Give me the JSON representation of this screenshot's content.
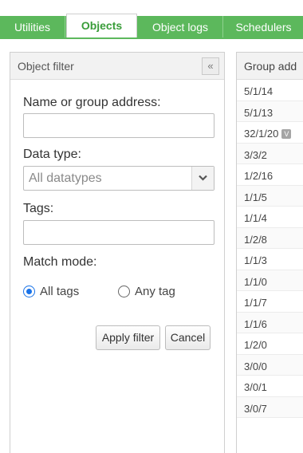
{
  "tabs": [
    {
      "label": "Utilities",
      "active": false
    },
    {
      "label": "Objects",
      "active": true
    },
    {
      "label": "Object logs",
      "active": false
    },
    {
      "label": "Schedulers",
      "active": false
    }
  ],
  "colors": {
    "accent": "#5cb85c",
    "active_tab_text": "#3a9d3a",
    "radio_checked": "#1a73e8"
  },
  "filter": {
    "title": "Object filter",
    "collapse_icon": "«",
    "name_label": "Name or group address:",
    "name_value": "",
    "datatype_label": "Data type:",
    "datatype_value": "All datatypes",
    "tags_label": "Tags:",
    "tags_value": "",
    "match_mode_label": "Match mode:",
    "match_all_label": "All tags",
    "match_any_label": "Any tag",
    "match_selected": "all",
    "apply_label": "Apply filter",
    "cancel_label": "Cancel"
  },
  "table": {
    "header": "Group add",
    "rows": [
      {
        "address": "5/1/14"
      },
      {
        "address": "5/1/13"
      },
      {
        "address": "32/1/20",
        "badge": "V"
      },
      {
        "address": "3/3/2"
      },
      {
        "address": "1/2/16"
      },
      {
        "address": "1/1/5"
      },
      {
        "address": "1/1/4"
      },
      {
        "address": "1/2/8"
      },
      {
        "address": "1/1/3"
      },
      {
        "address": "1/1/0"
      },
      {
        "address": "1/1/7"
      },
      {
        "address": "1/1/6"
      },
      {
        "address": "1/2/0"
      },
      {
        "address": "3/0/0"
      },
      {
        "address": "3/0/1"
      },
      {
        "address": "3/0/7"
      }
    ]
  }
}
